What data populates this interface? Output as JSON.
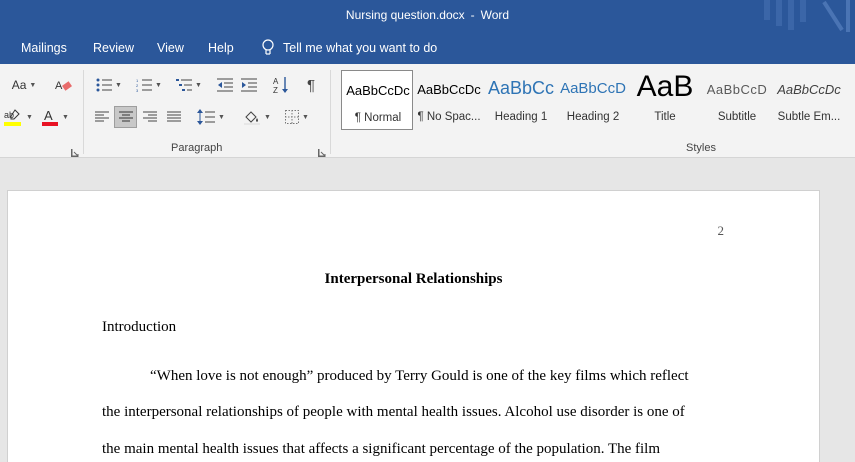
{
  "window": {
    "doc_name": "Nursing question.docx",
    "separator": "-",
    "app_name": "Word"
  },
  "tabs": [
    "Mailings",
    "Review",
    "View",
    "Help"
  ],
  "tell_me": {
    "text": "Tell me what you want to do"
  },
  "ribbon": {
    "font_group": {
      "change_case_label": "Aa"
    },
    "paragraph_group": {
      "label": "Paragraph"
    },
    "styles_group": {
      "label": "Styles"
    }
  },
  "styles": [
    {
      "preview": "AaBbCcDc",
      "name": "¶ Normal"
    },
    {
      "preview": "AaBbCcDc",
      "name": "¶ No Spac..."
    },
    {
      "preview": "AaBbCc",
      "name": "Heading 1"
    },
    {
      "preview": "AaBbCcD",
      "name": "Heading 2"
    },
    {
      "preview": "AaB",
      "name": "Title"
    },
    {
      "preview": "AaBbCcD",
      "name": "Subtitle"
    },
    {
      "preview": "AaBbCcDc",
      "name": "Subtle Em..."
    }
  ],
  "colors": {
    "word_blue": "#2b579a",
    "highlight_yellow": "#ffff00",
    "font_color_red": "#e81123",
    "heading_blue": "#2e74b5"
  },
  "document": {
    "page_number": "2",
    "title": "Interpersonal Relationships",
    "heading": "Introduction",
    "lines": [
      "“When love is not enough” produced by Terry Gould is one of the key films which reflect",
      "the interpersonal relationships of people with mental health issues. Alcohol use disorder is one of",
      "the main mental health issues that affects a significant percentage of the population. The film"
    ]
  }
}
